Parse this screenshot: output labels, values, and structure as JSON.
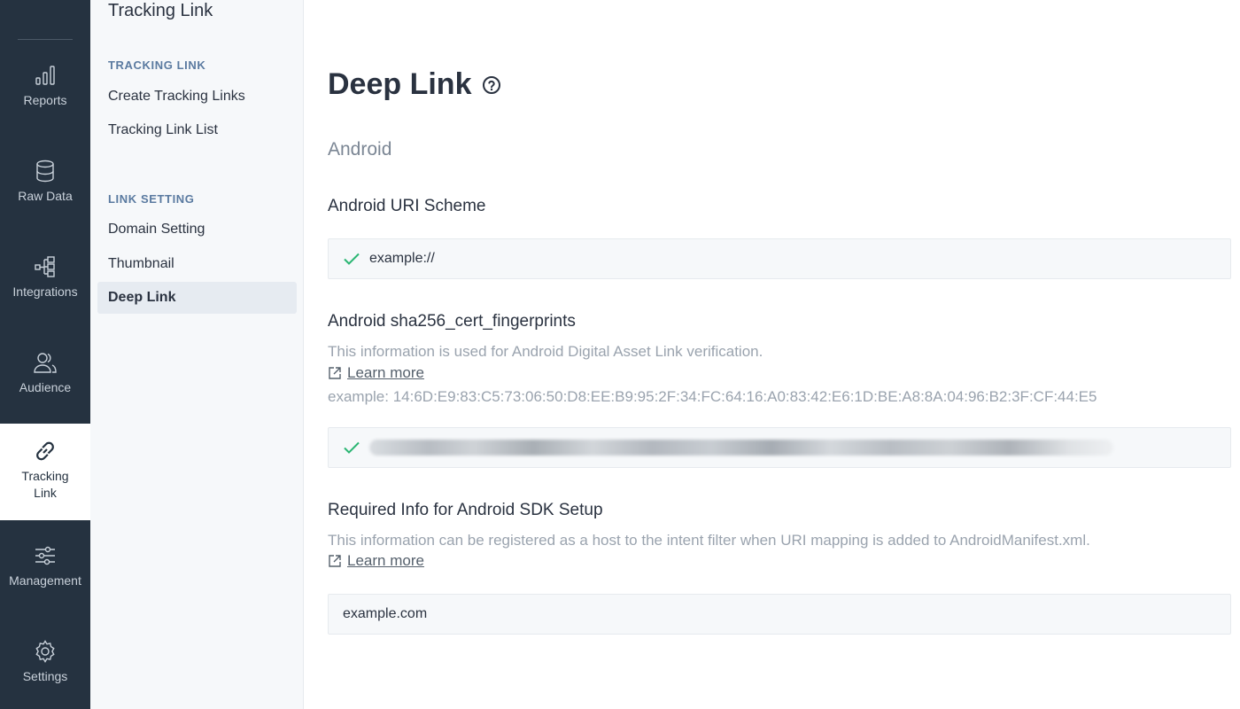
{
  "rail": {
    "items": [
      {
        "label": "Reports",
        "icon": "bar-chart-icon"
      },
      {
        "label": "Raw Data",
        "icon": "database-icon"
      },
      {
        "label": "Integrations",
        "icon": "integrations-icon"
      },
      {
        "label": "Audience",
        "icon": "users-icon"
      },
      {
        "label": "Tracking Link",
        "icon": "link-icon",
        "active": true
      },
      {
        "label": "Management",
        "icon": "sliders-icon"
      },
      {
        "label": "Settings",
        "icon": "gear-icon"
      }
    ]
  },
  "subnav": {
    "title": "Tracking Link",
    "sections": [
      {
        "heading": "TRACKING LINK",
        "items": [
          "Create Tracking Links",
          "Tracking Link List"
        ]
      },
      {
        "heading": "LINK SETTING",
        "items": [
          "Domain Setting",
          "Thumbnail",
          "Deep Link"
        ]
      }
    ],
    "active_item": "Deep Link"
  },
  "main": {
    "title": "Deep Link",
    "platform": "Android",
    "uri_scheme": {
      "label": "Android URI Scheme",
      "value": "example://"
    },
    "fingerprints": {
      "label": "Android sha256_cert_fingerprints",
      "description": "This information is used for Android Digital Asset Link verification.",
      "learn_more": "Learn more",
      "example": "example: 14:6D:E9:83:C5:73:06:50:D8:EE:B9:95:2F:34:FC:64:16:A0:83:42:E6:1D:BE:A8:8A:04:96:B2:3F:CF:44:E5"
    },
    "sdk_setup": {
      "label": "Required Info for Android SDK Setup",
      "description": "This information can be registered as a host to the intent filter when URI mapping is added to AndroidManifest.xml.",
      "learn_more": "Learn more",
      "value": "example.com"
    }
  },
  "colors": {
    "rail_bg": "#253240",
    "check_green": "#2bb673",
    "section_heading": "#5a7aa0"
  }
}
